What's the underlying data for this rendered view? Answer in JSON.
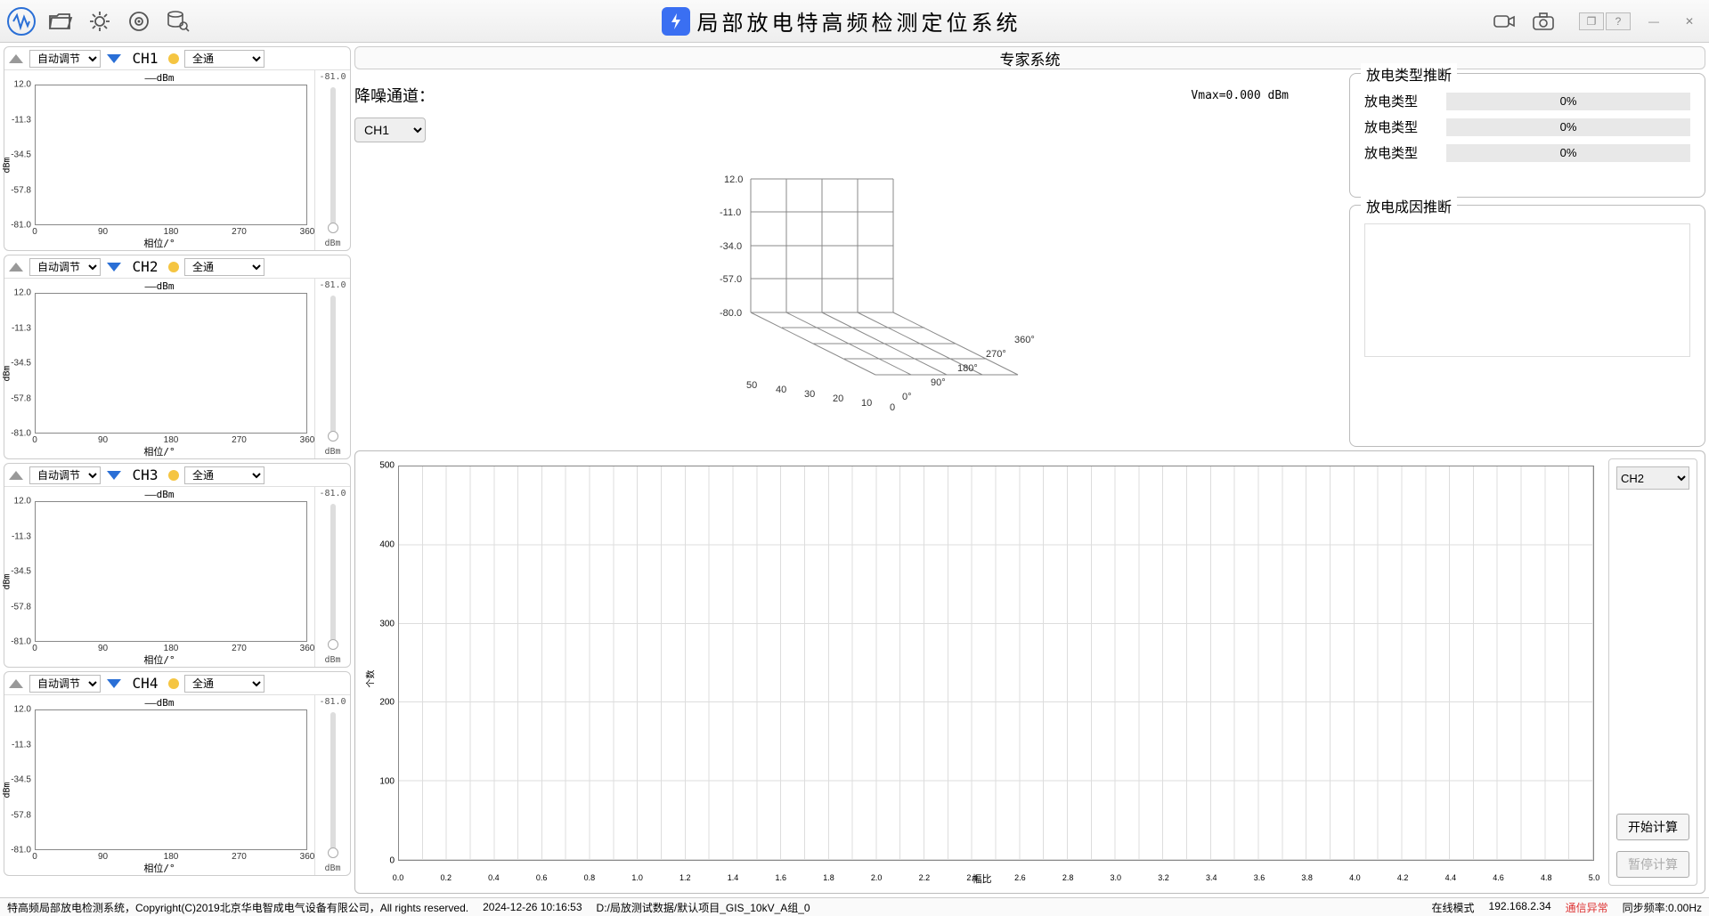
{
  "titlebar": {
    "app_title": "局部放电特高频检测定位系统"
  },
  "channels": [
    {
      "label": "CH1",
      "adjust": "自动调节",
      "filter": "全通",
      "legend": "——dBm",
      "slider_top": "-81.0",
      "slider_unit": "dBm",
      "xlabel": "相位/°",
      "ylabel": "dBm",
      "yticks": [
        "12.0",
        "-11.3",
        "-34.5",
        "-57.8",
        "-81.0"
      ],
      "xticks": [
        "0",
        "90",
        "180",
        "270",
        "360"
      ]
    },
    {
      "label": "CH2",
      "adjust": "自动调节",
      "filter": "全通",
      "legend": "——dBm",
      "slider_top": "-81.0",
      "slider_unit": "dBm",
      "xlabel": "相位/°",
      "ylabel": "dBm",
      "yticks": [
        "12.0",
        "-11.3",
        "-34.5",
        "-57.8",
        "-81.0"
      ],
      "xticks": [
        "0",
        "90",
        "180",
        "270",
        "360"
      ]
    },
    {
      "label": "CH3",
      "adjust": "自动调节",
      "filter": "全通",
      "legend": "——dBm",
      "slider_top": "-81.0",
      "slider_unit": "dBm",
      "xlabel": "相位/°",
      "ylabel": "dBm",
      "yticks": [
        "12.0",
        "-11.3",
        "-34.5",
        "-57.8",
        "-81.0"
      ],
      "xticks": [
        "0",
        "90",
        "180",
        "270",
        "360"
      ]
    },
    {
      "label": "CH4",
      "adjust": "自动调节",
      "filter": "全通",
      "legend": "——dBm",
      "slider_top": "-81.0",
      "slider_unit": "dBm",
      "xlabel": "相位/°",
      "ylabel": "dBm",
      "yticks": [
        "12.0",
        "-11.3",
        "-34.5",
        "-57.8",
        "-81.0"
      ],
      "xticks": [
        "0",
        "90",
        "180",
        "270",
        "360"
      ]
    }
  ],
  "expert_header": "专家系统",
  "noise_reduction": {
    "label": "降噪通道：",
    "channel": "CH1",
    "vmax": "Vmax=0.000 dBm",
    "z_ticks": [
      "12.0",
      "-11.0",
      "-34.0",
      "-57.0",
      "-80.0"
    ],
    "x_ticks": [
      "50",
      "40",
      "30",
      "20",
      "10",
      "0"
    ],
    "y_ticks": [
      "0°",
      "90°",
      "180°",
      "270°",
      "360°"
    ]
  },
  "discharge_type": {
    "title": "放电类型推断",
    "rows": [
      {
        "label": "放电类型",
        "value": "0%"
      },
      {
        "label": "放电类型",
        "value": "0%"
      },
      {
        "label": "放电类型",
        "value": "0%"
      }
    ]
  },
  "discharge_cause": {
    "title": "放电成因推断"
  },
  "bottom_chart": {
    "channel_sel": "CH2",
    "start_btn": "开始计算",
    "pause_btn": "暂停计算",
    "yticks": [
      "500",
      "400",
      "300",
      "200",
      "100",
      "0"
    ],
    "xticks": [
      "0.0",
      "0.2",
      "0.4",
      "0.6",
      "0.8",
      "1.0",
      "1.2",
      "1.4",
      "1.6",
      "1.8",
      "2.0",
      "2.2",
      "2.4",
      "2.6",
      "2.8",
      "3.0",
      "3.2",
      "3.4",
      "3.6",
      "3.8",
      "4.0",
      "4.2",
      "4.4",
      "4.6",
      "4.8",
      "5.0"
    ],
    "xlabel": "幅比",
    "ylabel": "个数"
  },
  "statusbar": {
    "copyright": "特高频局部放电检测系统，Copyright(C)2019北京华电智成电气设备有限公司，All rights reserved.",
    "timestamp": "2024-12-26 10:16:53",
    "path": "D:/局放测试数据/默认项目_GIS_10kV_A组_0",
    "mode": "在线模式",
    "ip": "192.168.2.34",
    "comm": "通信异常",
    "sync": "同步频率:0.00Hz"
  },
  "chart_data": [
    {
      "type": "scatter",
      "owner": "CH1",
      "x": [],
      "y": [],
      "xlabel": "相位/°",
      "ylabel": "dBm",
      "xlim": [
        0,
        360
      ],
      "ylim": [
        -81,
        12
      ]
    },
    {
      "type": "scatter",
      "owner": "CH2",
      "x": [],
      "y": [],
      "xlabel": "相位/°",
      "ylabel": "dBm",
      "xlim": [
        0,
        360
      ],
      "ylim": [
        -81,
        12
      ]
    },
    {
      "type": "scatter",
      "owner": "CH3",
      "x": [],
      "y": [],
      "xlabel": "相位/°",
      "ylabel": "dBm",
      "xlim": [
        0,
        360
      ],
      "ylim": [
        -81,
        12
      ]
    },
    {
      "type": "scatter",
      "owner": "CH4",
      "x": [],
      "y": [],
      "xlabel": "相位/°",
      "ylabel": "dBm",
      "xlim": [
        0,
        360
      ],
      "ylim": [
        -81,
        12
      ]
    },
    {
      "type": "bar",
      "owner": "bottom",
      "categories": [],
      "values": [],
      "xlabel": "幅比",
      "ylabel": "个数",
      "xlim": [
        0,
        5
      ],
      "ylim": [
        0,
        500
      ]
    }
  ]
}
